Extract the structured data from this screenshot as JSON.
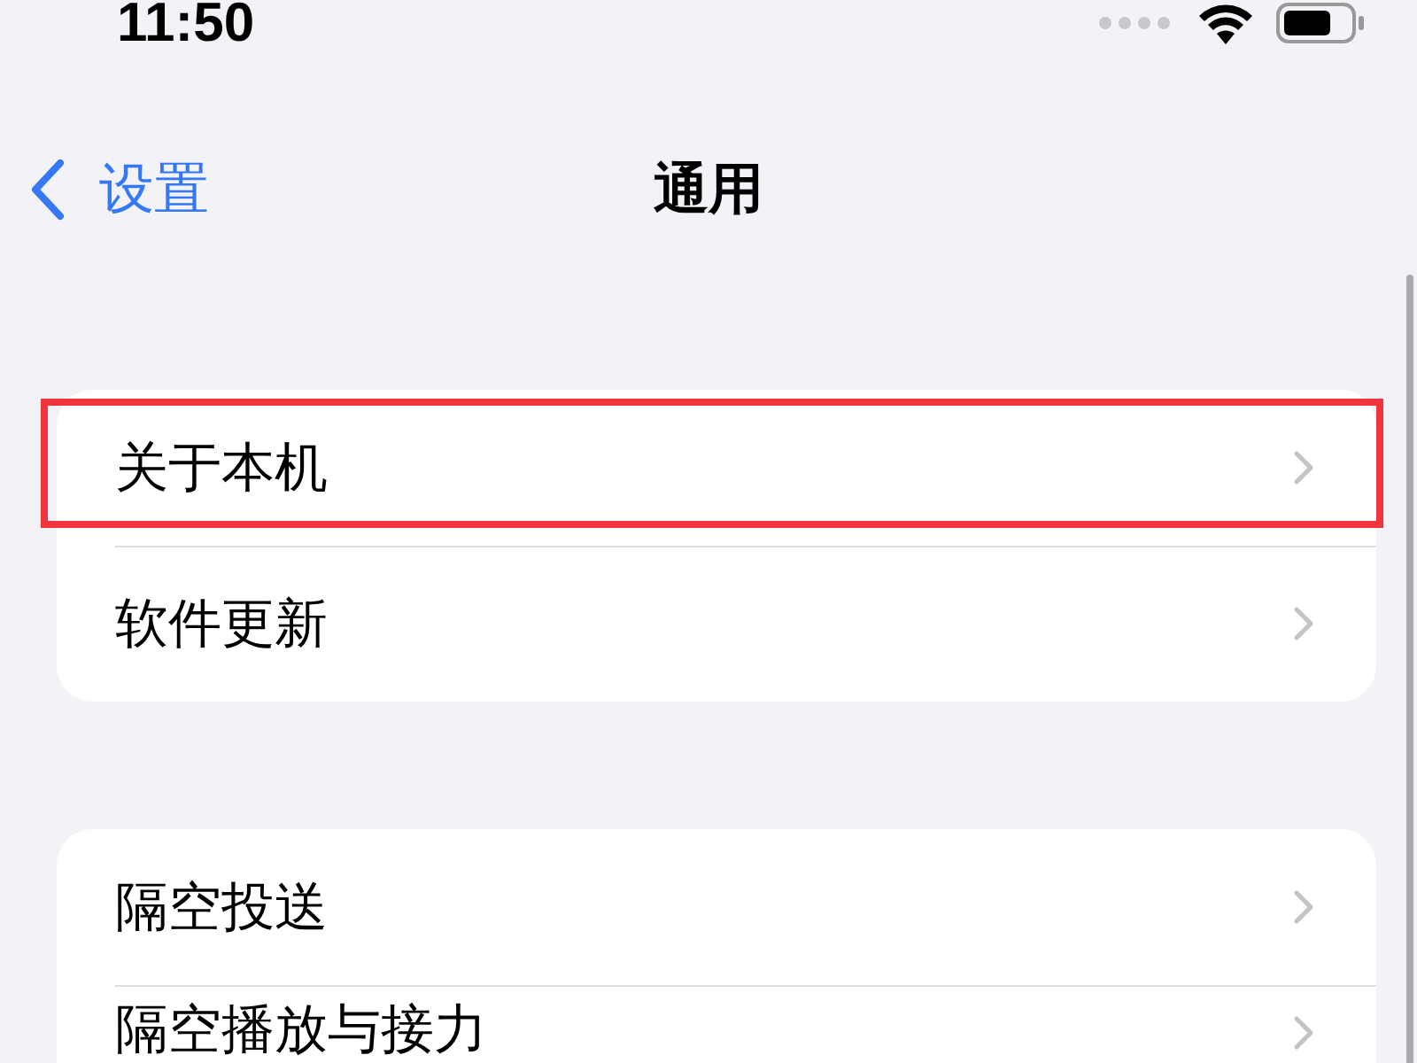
{
  "status_bar": {
    "time": "11:50"
  },
  "nav": {
    "back_label": "设置",
    "title": "通用"
  },
  "groups": [
    {
      "rows": [
        {
          "label": "关于本机",
          "highlighted": true
        },
        {
          "label": "软件更新",
          "highlighted": false
        }
      ]
    },
    {
      "rows": [
        {
          "label": "隔空投送",
          "highlighted": false
        },
        {
          "label": "隔空播放与接力",
          "highlighted": false
        }
      ]
    }
  ]
}
